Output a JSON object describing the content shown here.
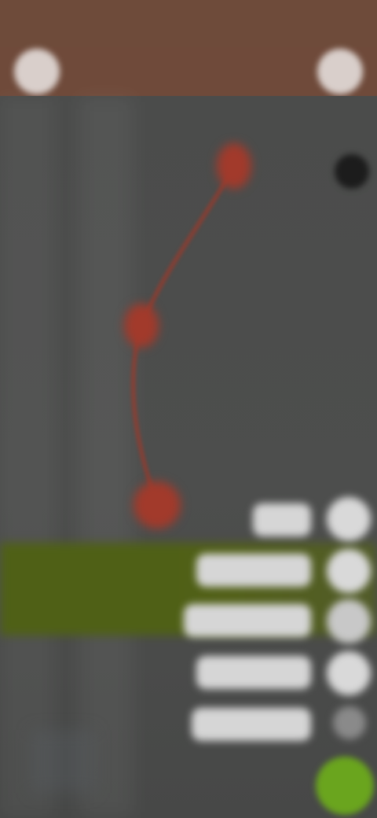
{
  "status_bar": {
    "time": "",
    "icons": ""
  },
  "app_bar": {
    "title": "",
    "left_icon": "back-icon",
    "right_icon": "menu-icon"
  },
  "map": {
    "route_color": "#a23a2b",
    "highlight_color": "#4f6016",
    "action_color": "#6aa51e"
  },
  "actions": {
    "pills": [
      "",
      "",
      "",
      "",
      ""
    ],
    "fab_icon": "add-icon"
  }
}
